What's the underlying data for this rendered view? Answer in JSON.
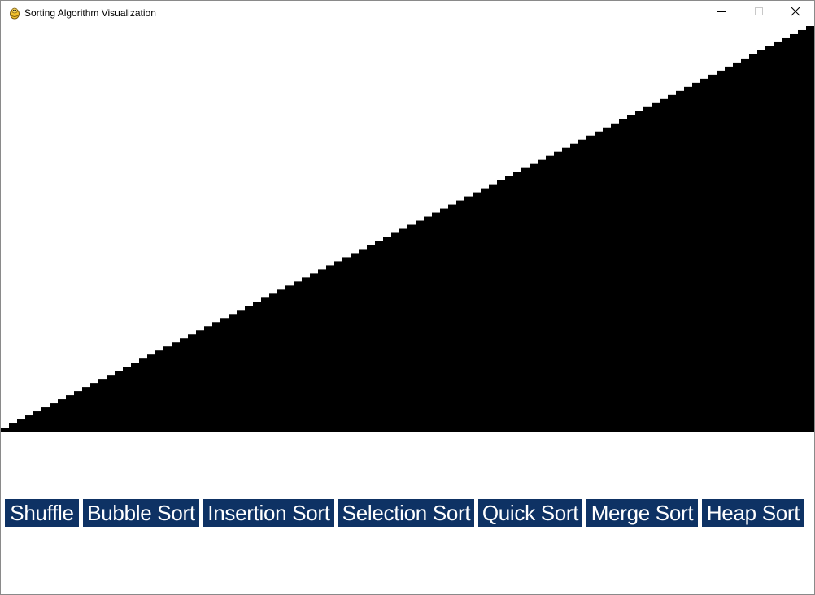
{
  "window": {
    "title": "Sorting Algorithm Visualization",
    "app_icon": "pygame-snake-icon",
    "controls": {
      "minimize_icon": "minimize-icon",
      "maximize_icon": "maximize-icon",
      "close_icon": "close-icon"
    }
  },
  "visualization": {
    "bar_color": "#000000",
    "background_color": "#ffffff",
    "bar_count": 100,
    "order": "ascending",
    "values_note_min": 1,
    "values_note_max": 100
  },
  "buttons": [
    {
      "id": "shuffle",
      "label": "Shuffle"
    },
    {
      "id": "bubble",
      "label": "Bubble Sort"
    },
    {
      "id": "insertion",
      "label": "Insertion Sort"
    },
    {
      "id": "selection",
      "label": "Selection Sort"
    },
    {
      "id": "quick",
      "label": "Quick Sort"
    },
    {
      "id": "merge",
      "label": "Merge Sort"
    },
    {
      "id": "heap",
      "label": "Heap Sort"
    }
  ],
  "button_color": "#0e3264",
  "button_text_color": "#ffffff"
}
